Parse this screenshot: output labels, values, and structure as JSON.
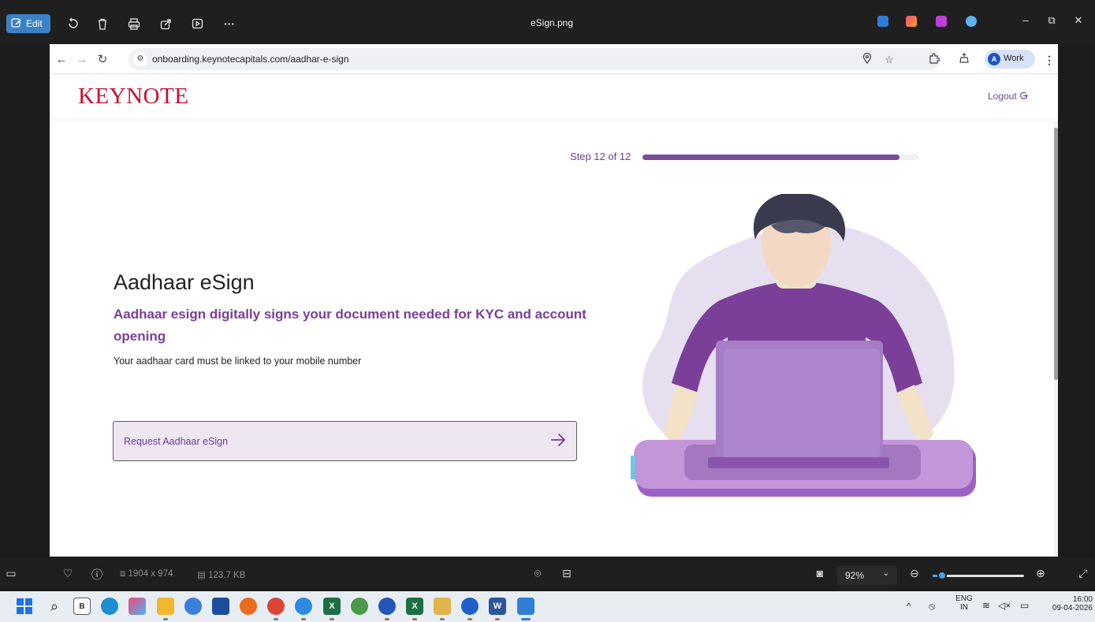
{
  "viewer": {
    "edit_label": "Edit",
    "file_name": "eSign.png",
    "dimensions": "1904 x 974",
    "file_size": "123.7 KB",
    "zoom": "92%",
    "zoom_level": 0.1
  },
  "browser": {
    "url": "onboarding.keynotecapitals.com/aadhar-e-sign",
    "profile_initial": "A",
    "profile_label": "Work"
  },
  "site": {
    "logo": "KEYNOTE",
    "logout_label": "Logout"
  },
  "progress": {
    "label": "Step 12 of 12",
    "fraction": 0.93
  },
  "content": {
    "title": "Aadhaar eSign",
    "subtitle": "Aadhaar esign digitally signs your document needed for KYC and account opening",
    "note": "Your aadhaar card must be linked to your mobile number",
    "button_label": "Request Aadhaar eSign"
  },
  "taskbar": {
    "lang_top": "ENG",
    "lang_bottom": "IN",
    "time": "16:00",
    "date": "09-04-2026"
  },
  "colors": {
    "brand_red": "#c8102e",
    "brand_purple": "#7a4a9c",
    "button_bg": "#eee6f1"
  }
}
